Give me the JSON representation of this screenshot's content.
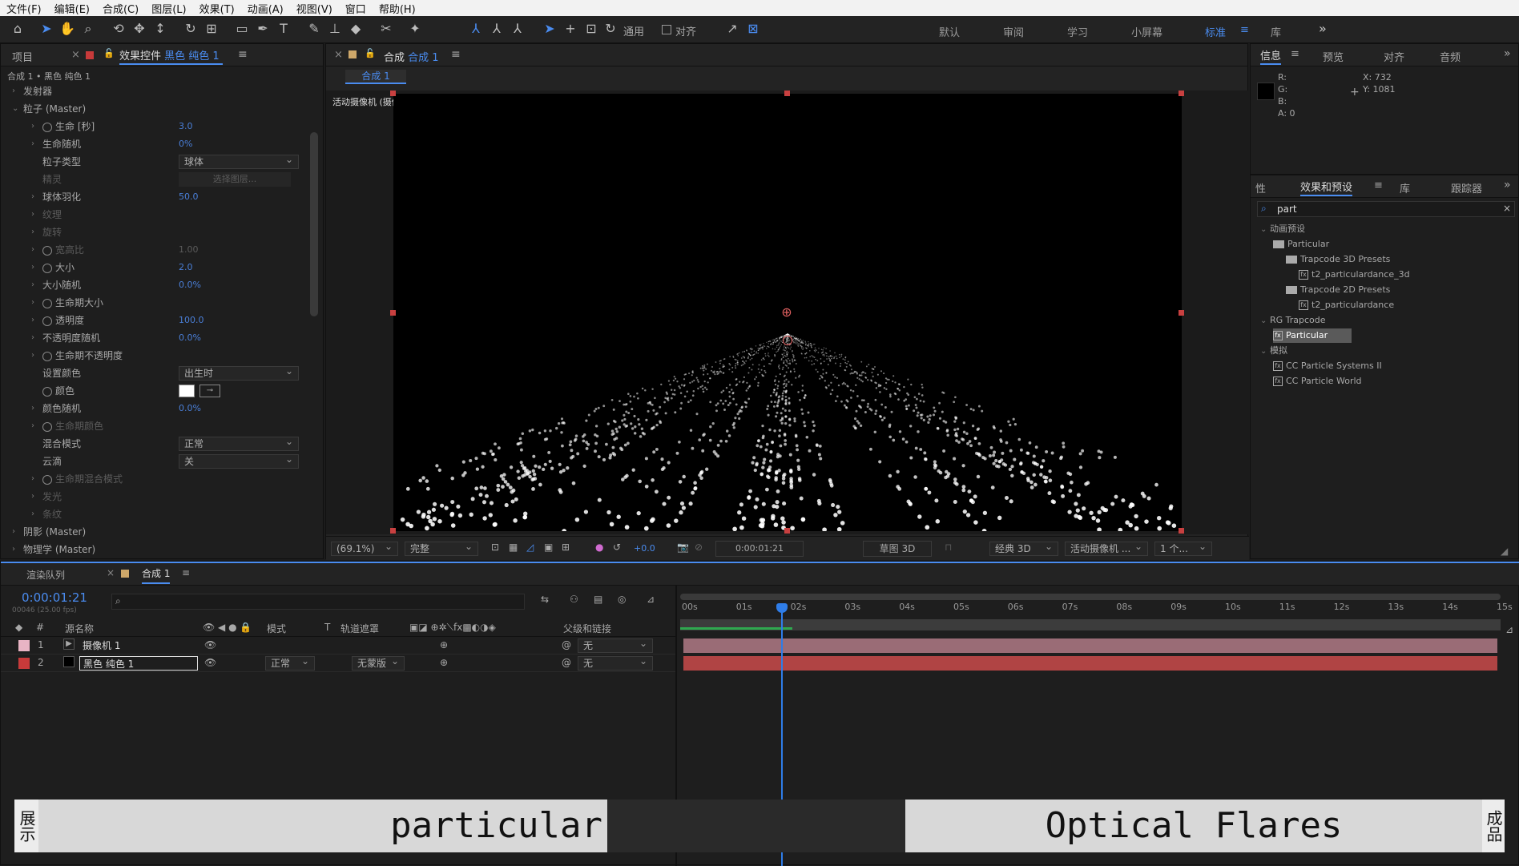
{
  "menu": [
    "文件(F)",
    "编辑(E)",
    "合成(C)",
    "图层(L)",
    "效果(T)",
    "动画(A)",
    "视图(V)",
    "窗口",
    "帮助(H)"
  ],
  "toolbar": {
    "snap": "通用",
    "align": "对齐",
    "workspaces": [
      "默认",
      "审阅",
      "学习",
      "小屏幕",
      "标准",
      "库"
    ],
    "expand": "»"
  },
  "effects_panel": {
    "tab_project": "项目",
    "tab_effects_prefix": "效果控件",
    "tab_effects_layer": "黑色 纯色 1",
    "breadcrumb": "合成 1 • 黑色 纯色 1",
    "rows": [
      {
        "label": "发射器",
        "indent": 1,
        "caret": "›"
      },
      {
        "label": "粒子 (Master)",
        "indent": 1,
        "caret": "⌄"
      },
      {
        "label": "生命 [秒]",
        "indent": 2,
        "caret": "›",
        "stop": true,
        "value": "3.0"
      },
      {
        "label": "生命随机",
        "indent": 2,
        "caret": "›",
        "value": "0%"
      },
      {
        "label": "粒子类型",
        "indent": 2,
        "caret": "",
        "dropdown": "球体"
      },
      {
        "label": "精灵",
        "indent": 2,
        "caret": "",
        "dim": true,
        "button": "选择图层..."
      },
      {
        "label": "球体羽化",
        "indent": 2,
        "caret": "›",
        "value": "50.0"
      },
      {
        "label": "纹理",
        "indent": 2,
        "caret": "›",
        "dim": true
      },
      {
        "label": "旋转",
        "indent": 2,
        "caret": "›",
        "dim": true
      },
      {
        "label": "宽高比",
        "indent": 2,
        "caret": "›",
        "dim": true,
        "stop": true,
        "value": "1.00"
      },
      {
        "label": "大小",
        "indent": 2,
        "caret": "›",
        "stop": true,
        "value": "2.0"
      },
      {
        "label": "大小随机",
        "indent": 2,
        "caret": "›",
        "value": "0.0%"
      },
      {
        "label": "生命期大小",
        "indent": 2,
        "caret": "›",
        "stop": true
      },
      {
        "label": "透明度",
        "indent": 2,
        "caret": "›",
        "stop": true,
        "value": "100.0"
      },
      {
        "label": "不透明度随机",
        "indent": 2,
        "caret": "›",
        "value": "0.0%"
      },
      {
        "label": "生命期不透明度",
        "indent": 2,
        "caret": "›",
        "stop": true
      },
      {
        "label": "设置颜色",
        "indent": 2,
        "caret": "",
        "dropdown": "出生时"
      },
      {
        "label": "颜色",
        "indent": 2,
        "caret": "",
        "stop": true,
        "swatch": true
      },
      {
        "label": "颜色随机",
        "indent": 2,
        "caret": "›",
        "value": "0.0%"
      },
      {
        "label": "生命期颜色",
        "indent": 2,
        "caret": "›",
        "dim": true,
        "stop": true
      },
      {
        "label": "混合模式",
        "indent": 2,
        "caret": "",
        "dropdown": "正常"
      },
      {
        "label": "云滴",
        "indent": 2,
        "caret": "",
        "dropdown": "关"
      },
      {
        "label": "生命期混合模式",
        "indent": 2,
        "caret": "›",
        "dim": true,
        "stop": true
      },
      {
        "label": "发光",
        "indent": 2,
        "caret": "›",
        "dim": true
      },
      {
        "label": "条纹",
        "indent": 2,
        "caret": "›",
        "dim": true
      },
      {
        "label": "阴影 (Master)",
        "indent": 1,
        "caret": "›"
      },
      {
        "label": "物理学 (Master)",
        "indent": 1,
        "caret": "›"
      }
    ]
  },
  "comp_panel": {
    "tab_prefix": "合成",
    "tab_name": "合成 1",
    "subtab": "合成 1",
    "camera_label": "活动摄像机 (摄像机 1)",
    "footer": {
      "zoom": "(69.1%)",
      "quality": "完整",
      "exposure": "+0.0",
      "timecode": "0:00:01:21",
      "draft": "草图 3D",
      "renderer": "经典 3D",
      "camera": "活动摄像机 ...",
      "views": "1 个..."
    }
  },
  "info_panel": {
    "tabs": [
      "信息",
      "预览",
      "对齐",
      "音频"
    ],
    "r": "R:",
    "g": "G:",
    "b": "B:",
    "a": "A: 0",
    "x": "X: 732",
    "y": "Y: 1081"
  },
  "presets_panel": {
    "tabs": [
      "性",
      "效果和预设",
      "库",
      "跟踪器"
    ],
    "search": "part",
    "tree": [
      {
        "label": "动画预设",
        "indent": 0,
        "kind": "caret"
      },
      {
        "label": "Particular",
        "indent": 1,
        "kind": "folder"
      },
      {
        "label": "Trapcode 3D Presets",
        "indent": 2,
        "kind": "folder"
      },
      {
        "label": "t2_particulardance_3d",
        "indent": 3,
        "kind": "file"
      },
      {
        "label": "Trapcode 2D Presets",
        "indent": 2,
        "kind": "folder"
      },
      {
        "label": "t2_particulardance",
        "indent": 3,
        "kind": "file"
      },
      {
        "label": "RG Trapcode",
        "indent": 0,
        "kind": "caret"
      },
      {
        "label": "Particular",
        "indent": 1,
        "kind": "fx",
        "selected": true
      },
      {
        "label": "模拟",
        "indent": 0,
        "kind": "caret"
      },
      {
        "label": "CC Particle Systems II",
        "indent": 1,
        "kind": "fx"
      },
      {
        "label": "CC Particle World",
        "indent": 1,
        "kind": "fx"
      }
    ]
  },
  "timeline": {
    "tab_render": "渲染队列",
    "tab_comp": "合成 1",
    "timecode": "0:00:01:21",
    "fps": "00046 (25.00 fps)",
    "cols": {
      "num": "#",
      "source": "源名称",
      "mode": "模式",
      "t": "T",
      "trkmat": "轨道遮罩",
      "parent": "父级和链接"
    },
    "ruler": [
      "00s",
      "01s",
      "02s",
      "03s",
      "04s",
      "05s",
      "06s",
      "07s",
      "08s",
      "09s",
      "10s",
      "11s",
      "12s",
      "13s",
      "14s",
      "15s"
    ],
    "layers": [
      {
        "num": "1",
        "name": "摄像机 1",
        "color": "#e8b4c4",
        "mode": "",
        "trkmat": "",
        "parent": "无",
        "bar": "#9a6c76"
      },
      {
        "num": "2",
        "name": "黑色 纯色 1",
        "color": "#c83a3a",
        "mode": "正常",
        "trkmat": "无蒙版",
        "parent": "无",
        "bar": "#b04444"
      }
    ]
  },
  "caption": {
    "left": "展示",
    "text1": "particular",
    "text2": "Optical Flares",
    "right": "成品"
  }
}
